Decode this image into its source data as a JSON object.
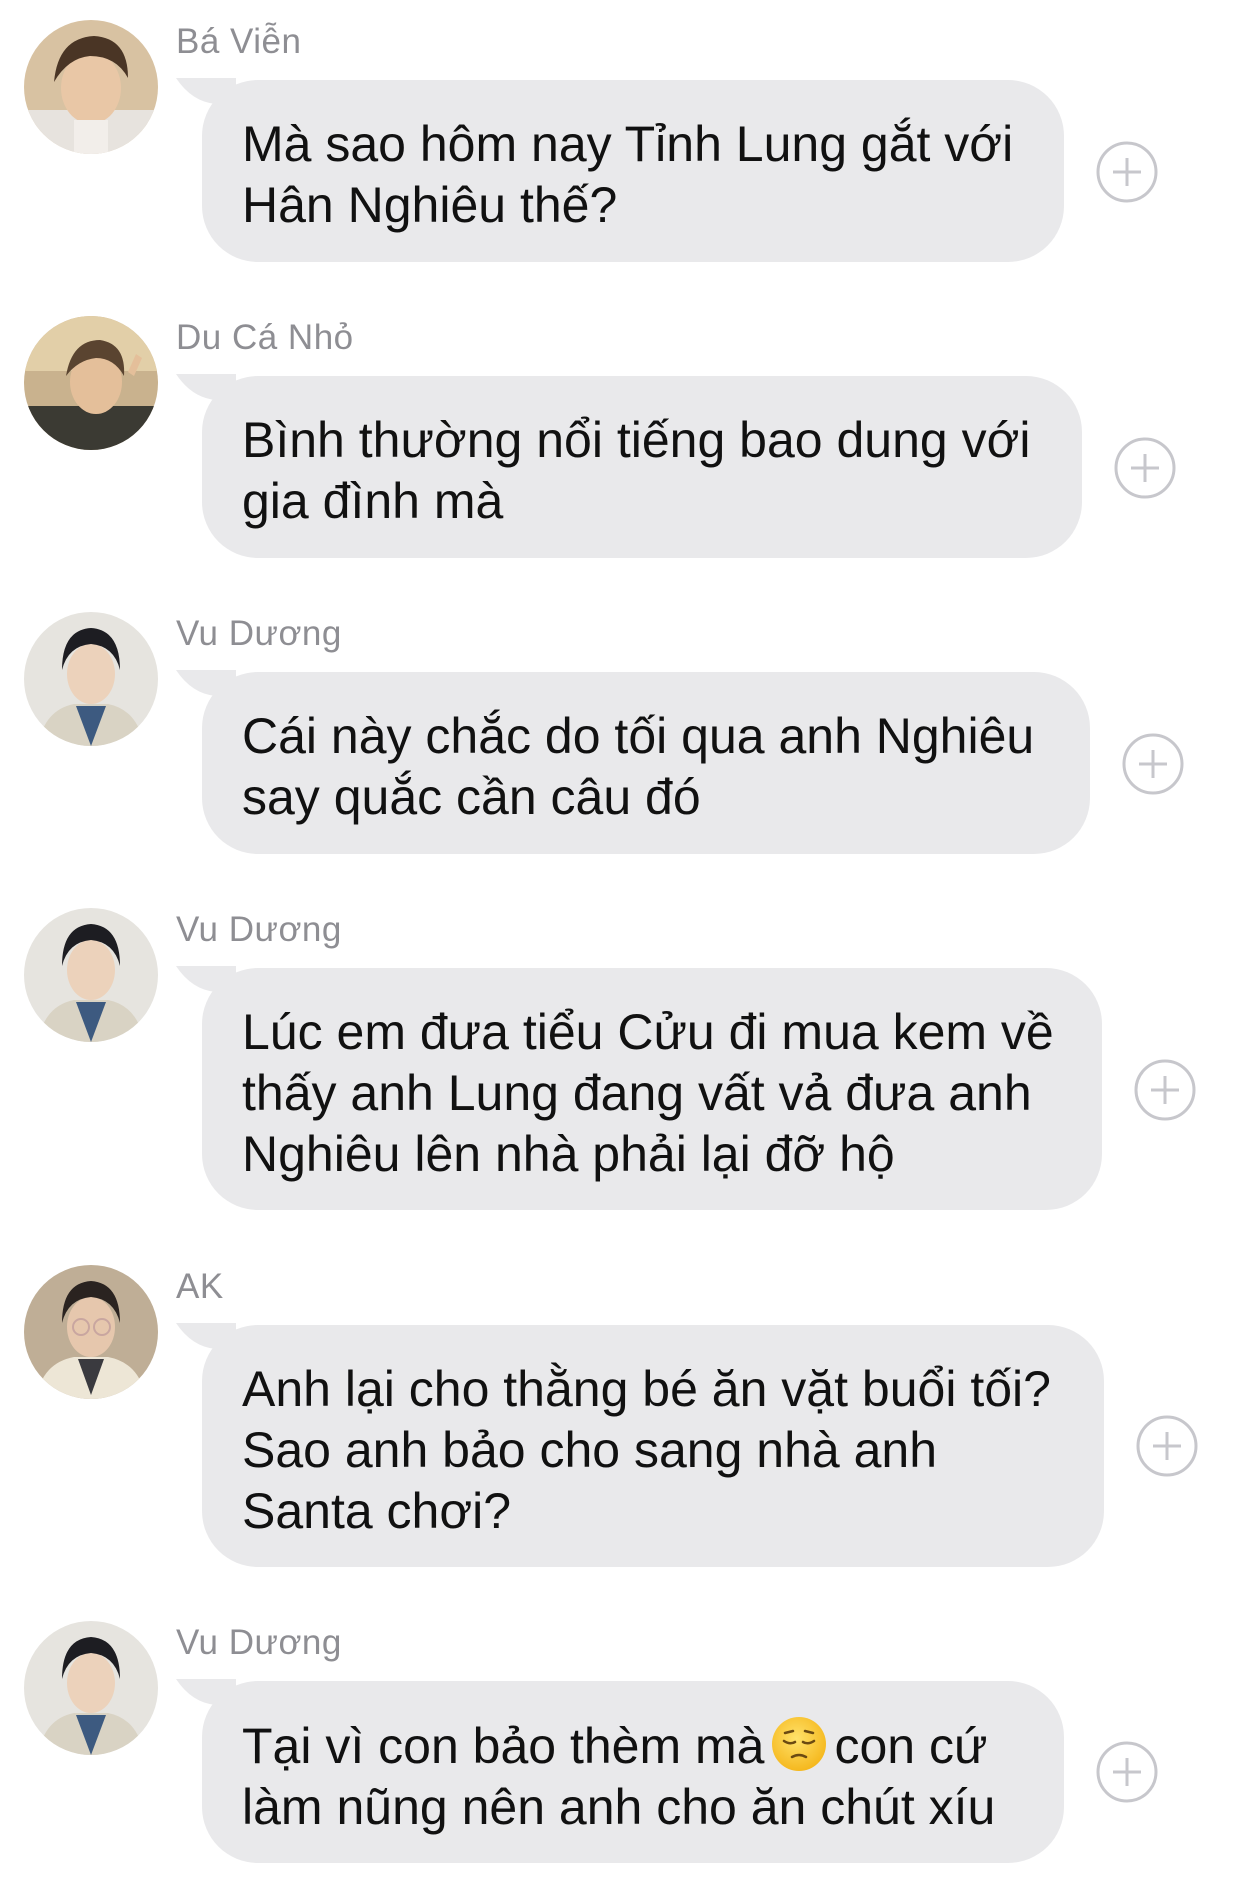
{
  "messages": [
    {
      "sender": "Bá Viễn",
      "text": "Mà sao hôm nay Tỉnh Lung gắt với\nHân Nghiêu thế?",
      "avatar": "person-light-hair"
    },
    {
      "sender": "Du Cá Nhỏ",
      "text": "Bình thường nổi tiếng bao dung với\ngia đình mà",
      "avatar": "person-peace-sign"
    },
    {
      "sender": "Vu Dương",
      "text": "Cái này chắc do tối qua anh Nghiêu\nsay quắc cần câu đó",
      "avatar": "person-dark-hair"
    },
    {
      "sender": "Vu Dương",
      "text": "Lúc em đưa tiểu Cửu đi mua kem về\nthấy anh Lung đang vất vả đưa anh\nNghiêu lên nhà phải lại đỡ hộ",
      "avatar": "person-dark-hair"
    },
    {
      "sender": "AK",
      "text": "Anh lại cho thằng bé ăn vặt buổi tối?\nSao anh bảo cho sang nhà anh\nSanta chơi?",
      "avatar": "person-glasses"
    },
    {
      "sender": "Vu Dương",
      "text_before": "Tại vì con bảo thèm mà",
      "text_after": "con cứ\nlàm nũng nên anh cho ăn chút xíu",
      "emoji": "pensive-face-emoji",
      "avatar": "person-dark-hair"
    }
  ],
  "colors": {
    "bubble": "#e9e9eb",
    "sender": "#8e8e93",
    "text": "#111111",
    "plus_icon": "#c7c7cc"
  }
}
